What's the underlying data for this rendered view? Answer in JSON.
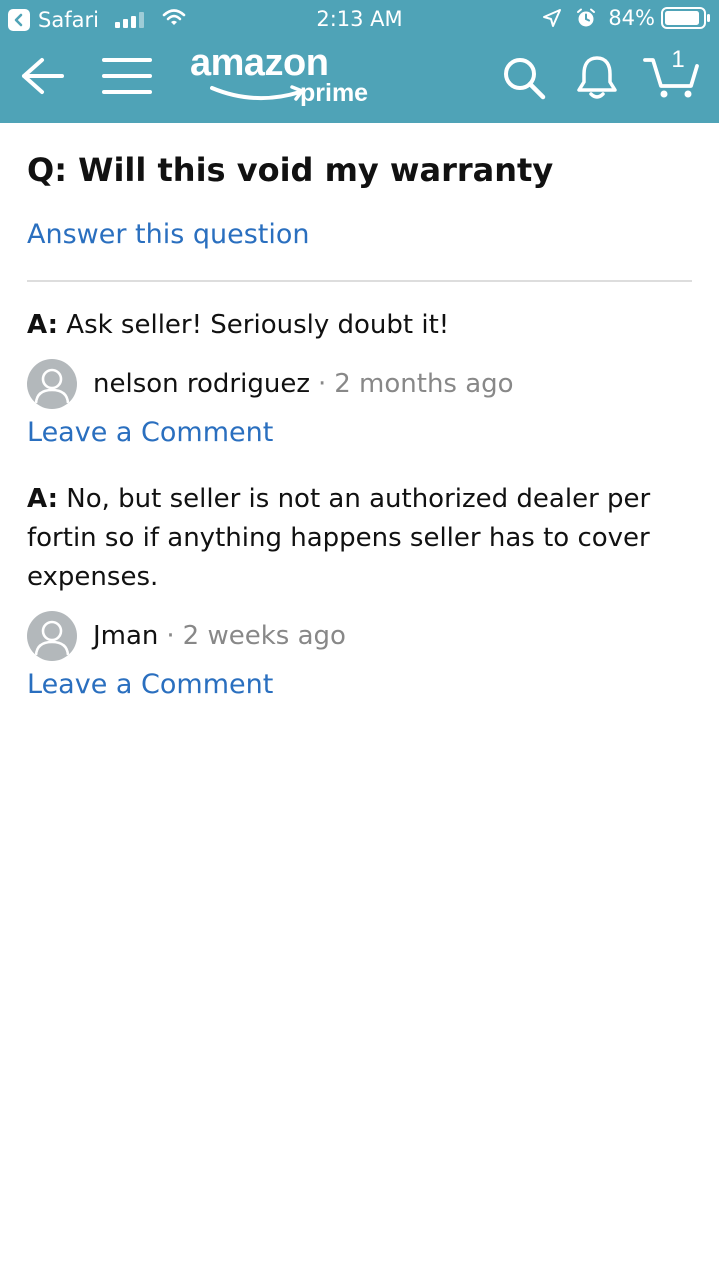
{
  "status_bar": {
    "app": "Safari",
    "time": "2:13 AM",
    "battery": "84%"
  },
  "nav": {
    "logo_word": "amazon",
    "logo_sub": "prime",
    "cart_count": "1"
  },
  "colors": {
    "header": "#4fa3b7",
    "link": "#2a6fbf",
    "muted": "#888888"
  },
  "question": {
    "text": "Q: Will this void my warranty",
    "answer_link": "Answer this question"
  },
  "answers": [
    {
      "prefix": "A:",
      "text": "Ask seller! Seriously doubt it!",
      "author": "nelson rodriguez",
      "separator": "·",
      "date": "2 months ago",
      "comment_link": "Leave a Comment"
    },
    {
      "prefix": "A:",
      "text": "No, but seller is not an authorized dealer per fortin so if anything happens seller has to cover expenses.",
      "author": "Jman",
      "separator": "·",
      "date": "2 weeks ago",
      "comment_link": "Leave a Comment"
    }
  ]
}
